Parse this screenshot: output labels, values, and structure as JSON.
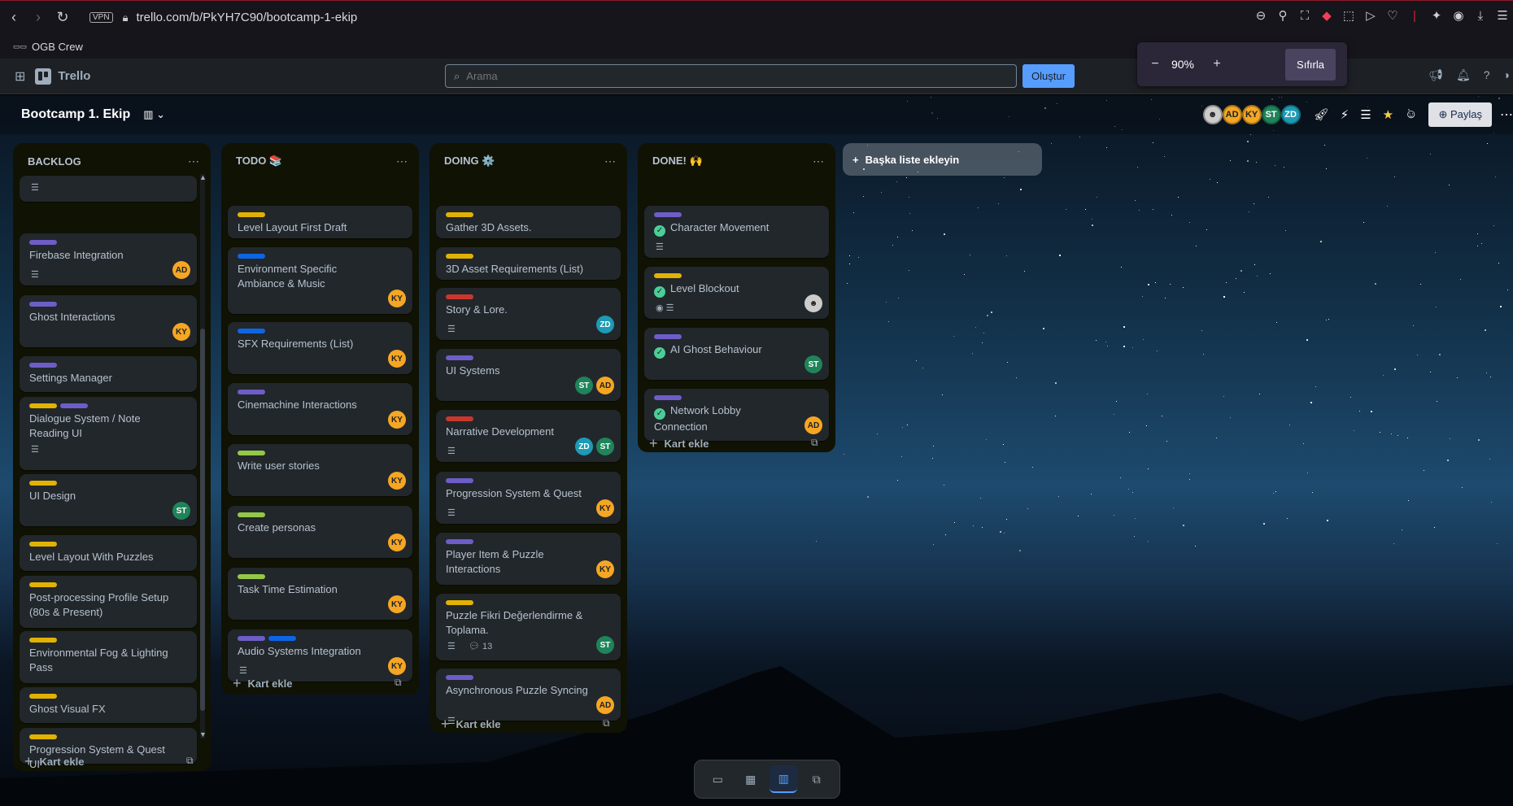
{
  "browser": {
    "url": "trello.com/b/PkYH7C90/bootcamp-1-ekip",
    "vpn": "VPN",
    "bookmark": "OGB Crew"
  },
  "zoom": {
    "value": "90%",
    "minus": "−",
    "plus": "+",
    "reset": "Sıfırla"
  },
  "header": {
    "brand": "Trello",
    "search_placeholder": "Arama",
    "create": "Oluştur"
  },
  "board": {
    "title": "Bootcamp 1. Ekip",
    "share": "Paylaş",
    "members": [
      "AD",
      "KY",
      "ST",
      "ZD"
    ],
    "add_list": "Başka liste ekleyin"
  },
  "add_card_label": "Kart ekle",
  "lists": [
    {
      "title": "BACKLOG",
      "cards": [
        {
          "title": "Firebase Integration",
          "labels": [
            "purple"
          ],
          "members": [
            "AD"
          ]
        },
        {
          "title": "Ghost Interactions",
          "labels": [
            "purple"
          ],
          "members": [
            "KY"
          ]
        },
        {
          "title": "Settings Manager",
          "labels": [
            "purple"
          ],
          "members": []
        },
        {
          "title": "Dialogue System / Note Reading UI",
          "labels": [
            "yellow",
            "purple"
          ],
          "members": []
        },
        {
          "title": "UI Design",
          "labels": [
            "yellow"
          ],
          "members": [
            "ST"
          ]
        },
        {
          "title": "Level Layout With Puzzles",
          "labels": [
            "yellow"
          ],
          "members": []
        },
        {
          "title": "Post-processing Profile Setup (80s & Present)",
          "labels": [
            "yellow"
          ],
          "members": []
        },
        {
          "title": "Environmental Fog & Lighting Pass",
          "labels": [
            "yellow"
          ],
          "members": []
        },
        {
          "title": "Ghost Visual FX",
          "labels": [
            "yellow"
          ],
          "members": []
        },
        {
          "title": "Progression System & Quest UI",
          "labels": [
            "yellow"
          ],
          "members": []
        }
      ]
    },
    {
      "title": "TODO 📚",
      "cards": [
        {
          "title": "Level Layout First Draft",
          "labels": [
            "yellow"
          ],
          "members": []
        },
        {
          "title": "Environment Specific Ambiance & Music",
          "labels": [
            "blue"
          ],
          "members": [
            "KY"
          ]
        },
        {
          "title": "SFX Requirements (List)",
          "labels": [
            "blue"
          ],
          "members": [
            "KY"
          ]
        },
        {
          "title": "Cinemachine Interactions",
          "labels": [
            "purple"
          ],
          "members": [
            "KY"
          ]
        },
        {
          "title": "Write user stories",
          "labels": [
            "green"
          ],
          "members": [
            "KY"
          ]
        },
        {
          "title": "Create personas",
          "labels": [
            "green"
          ],
          "members": [
            "KY"
          ]
        },
        {
          "title": "Task Time Estimation",
          "labels": [
            "green"
          ],
          "members": [
            "KY"
          ]
        },
        {
          "title": "Audio Systems Integration",
          "labels": [
            "purple",
            "blue"
          ],
          "members": [
            "KY"
          ]
        }
      ]
    },
    {
      "title": "DOING ⚙️",
      "cards": [
        {
          "title": "Gather 3D Assets.",
          "labels": [
            "yellow"
          ],
          "members": []
        },
        {
          "title": "3D Asset Requirements (List)",
          "labels": [
            "yellow"
          ],
          "members": []
        },
        {
          "title": "Story & Lore.",
          "labels": [
            "red"
          ],
          "members": [
            "ZD"
          ]
        },
        {
          "title": "UI Systems",
          "labels": [
            "purple"
          ],
          "members": [
            "ST",
            "AD"
          ]
        },
        {
          "title": "Narrative Development",
          "labels": [
            "red"
          ],
          "members": [
            "ZD",
            "ST"
          ]
        },
        {
          "title": "Progression System & Quest",
          "labels": [
            "purple"
          ],
          "members": [
            "KY"
          ]
        },
        {
          "title": "Player Item & Puzzle Interactions",
          "labels": [
            "purple"
          ],
          "members": [
            "KY"
          ]
        },
        {
          "title": "Puzzle Fikri Değerlendirme & Toplama.",
          "labels": [
            "yellow"
          ],
          "members": [
            "ST"
          ],
          "comments": "13"
        },
        {
          "title": "Asynchronous Puzzle Syncing",
          "labels": [
            "purple"
          ],
          "members": [
            "AD"
          ]
        }
      ]
    },
    {
      "title": "DONE! 🙌",
      "cards": [
        {
          "title": "Character Movement",
          "labels": [
            "purple"
          ],
          "members": []
        },
        {
          "title": "Level Blockout",
          "labels": [
            "yellow"
          ],
          "members": []
        },
        {
          "title": "AI Ghost Behaviour",
          "labels": [
            "purple"
          ],
          "members": [
            "ST"
          ]
        },
        {
          "title": "Network Lobby Connection",
          "labels": [
            "purple"
          ],
          "members": [
            "AD"
          ]
        }
      ]
    }
  ],
  "icons": {
    "back": "arrow-left-icon",
    "forward": "arrow-right-icon",
    "reload": "reload-icon",
    "apps": "apps-grid-icon",
    "star": "star-icon",
    "template": "template-icon"
  },
  "colors": {
    "accent": "#579dff",
    "yellow_label": "#e2b203",
    "purple_label": "#6e5dc6",
    "blue_label": "#0c66e4",
    "green_label": "#94c748",
    "red_label": "#c9372c",
    "list_bg": "#101204",
    "card_bg": "#22272b"
  }
}
